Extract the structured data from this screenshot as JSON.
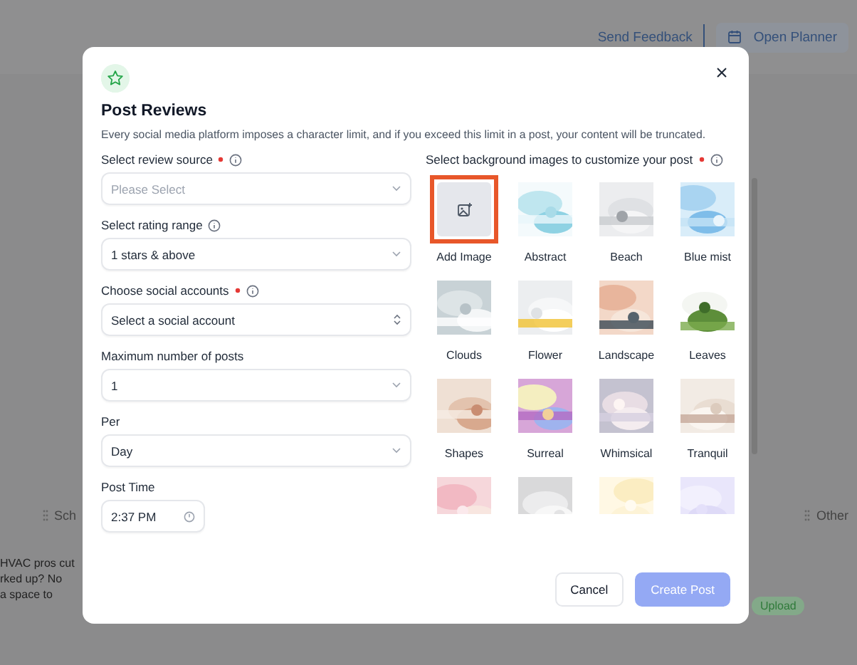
{
  "page": {
    "header_buttons": [
      {
        "label": "Send Feedback",
        "kind": "link"
      },
      {
        "label": "Open Planner",
        "kind": "button"
      }
    ],
    "columns": [
      "Sch",
      "Other"
    ],
    "post_lines": [
      "HVAC pros cut",
      "rked up? No",
      "a space to"
    ],
    "badge": "Upload"
  },
  "dialog": {
    "title": "Post Reviews",
    "description": "Every social media platform imposes a character limit, and if you exceed this limit in a post, your content will be truncated.",
    "fields": [
      {
        "label": "Select review source",
        "required": true,
        "info": true,
        "kind": "select",
        "placeholder": "Please Select"
      },
      {
        "label": "Select rating range",
        "required": false,
        "info": true,
        "kind": "select",
        "value": "1 stars & above"
      },
      {
        "label": "Choose social accounts",
        "required": true,
        "info": true,
        "kind": "combobox",
        "value": "Select a social account"
      },
      {
        "label": "Maximum number of posts",
        "required": false,
        "info": false,
        "kind": "select",
        "value": "1"
      },
      {
        "label": "Per",
        "required": false,
        "info": false,
        "kind": "select",
        "value": "Day"
      },
      {
        "label": "Post Time",
        "required": false,
        "info": false,
        "kind": "time",
        "value": "2:37 PM"
      }
    ],
    "images_label": "Select background images to customize your post",
    "images_required": true,
    "images": [
      {
        "kind": "add",
        "name": "Add Image",
        "selected": true
      },
      {
        "kind": "picture",
        "name": "Abstract",
        "selected": false
      },
      {
        "kind": "picture",
        "name": "Beach",
        "selected": false
      },
      {
        "kind": "picture",
        "name": "Blue mist",
        "selected": false
      },
      {
        "kind": "picture",
        "name": "Clouds",
        "selected": false
      },
      {
        "kind": "picture",
        "name": "Flower",
        "selected": false
      },
      {
        "kind": "picture",
        "name": "Landscape",
        "selected": false
      },
      {
        "kind": "picture",
        "name": "Leaves",
        "selected": false
      },
      {
        "kind": "picture",
        "name": "Shapes",
        "selected": false
      },
      {
        "kind": "picture",
        "name": "Surreal",
        "selected": false
      },
      {
        "kind": "picture",
        "name": "Whimsical",
        "selected": false
      },
      {
        "kind": "picture",
        "name": "Tranquil",
        "selected": false
      },
      {
        "kind": "picture",
        "selected": false
      },
      {
        "kind": "picture",
        "selected": false
      },
      {
        "kind": "picture",
        "selected": false
      },
      {
        "kind": "picture",
        "selected": false
      }
    ],
    "buttons": [
      {
        "label": "Cancel",
        "kind": "secondary",
        "disabled": false
      },
      {
        "label": "Create Post",
        "kind": "primary",
        "disabled": true
      }
    ]
  }
}
